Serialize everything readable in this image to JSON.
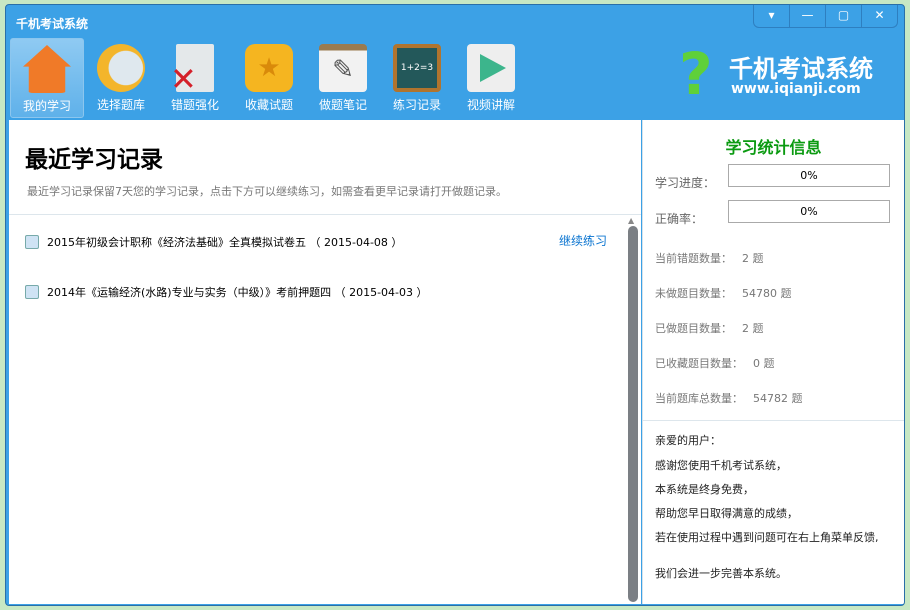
{
  "window": {
    "title": "千机考试系统",
    "controls": [
      "▾",
      "—",
      "▢",
      "✕"
    ]
  },
  "nav": [
    {
      "label": "我的学习",
      "icon": "home-icon",
      "color": "#f07a28"
    },
    {
      "label": "选择题库",
      "icon": "book-icon",
      "color": "#f3b52b"
    },
    {
      "label": "错题强化",
      "icon": "error-document-icon",
      "color": "#d8dde0"
    },
    {
      "label": "收藏试题",
      "icon": "star-folder-icon",
      "color": "#f5b520"
    },
    {
      "label": "做题笔记",
      "icon": "notebook-pencil-icon",
      "color": "#ebebeb"
    },
    {
      "label": "练习记录",
      "icon": "chalkboard-icon",
      "color": "#23585a"
    },
    {
      "label": "视频讲解",
      "icon": "play-icon",
      "color": "#eeeeee"
    }
  ],
  "logo": {
    "title": "千机考试系统",
    "url": "www.iqianji.com"
  },
  "main": {
    "title": "最近学习记录",
    "subtitle": "最近学习记录保留7天您的学习记录，点击下方可以继续练习，如需查看更早记录请打开做题记录。",
    "records": [
      {
        "text": "2015年初级会计职称《经济法基础》全真模拟试卷五 （ 2015-04-08 ）"
      },
      {
        "text": "2014年《运输经济(水路)专业与实务（中级）》考前押题四 （ 2015-04-03 ）"
      }
    ],
    "continue_label": "继续练习"
  },
  "stats": {
    "title": "学习统计信息",
    "progress_label": "学习进度：",
    "progress_value": "0%",
    "accuracy_label": "正确率：",
    "accuracy_value": "0%",
    "items": [
      {
        "label": "当前错题数量：",
        "value": "2 题"
      },
      {
        "label": "未做题目数量：",
        "value": "54780 题"
      },
      {
        "label": "已做题目数量：",
        "value": "2 题"
      },
      {
        "label": "已收藏题目数量：",
        "value": "0 题"
      },
      {
        "label": "当前题库总数量：",
        "value": "54782 题"
      }
    ],
    "message": [
      "亲爱的用户：",
      "感谢您使用千机考试系统，",
      "本系统是终身免费，",
      "帮助您早日取得满意的成绩，",
      "若在使用过程中遇到问题可在右上角菜单反馈,",
      "我们会进一步完善本系统。"
    ]
  }
}
